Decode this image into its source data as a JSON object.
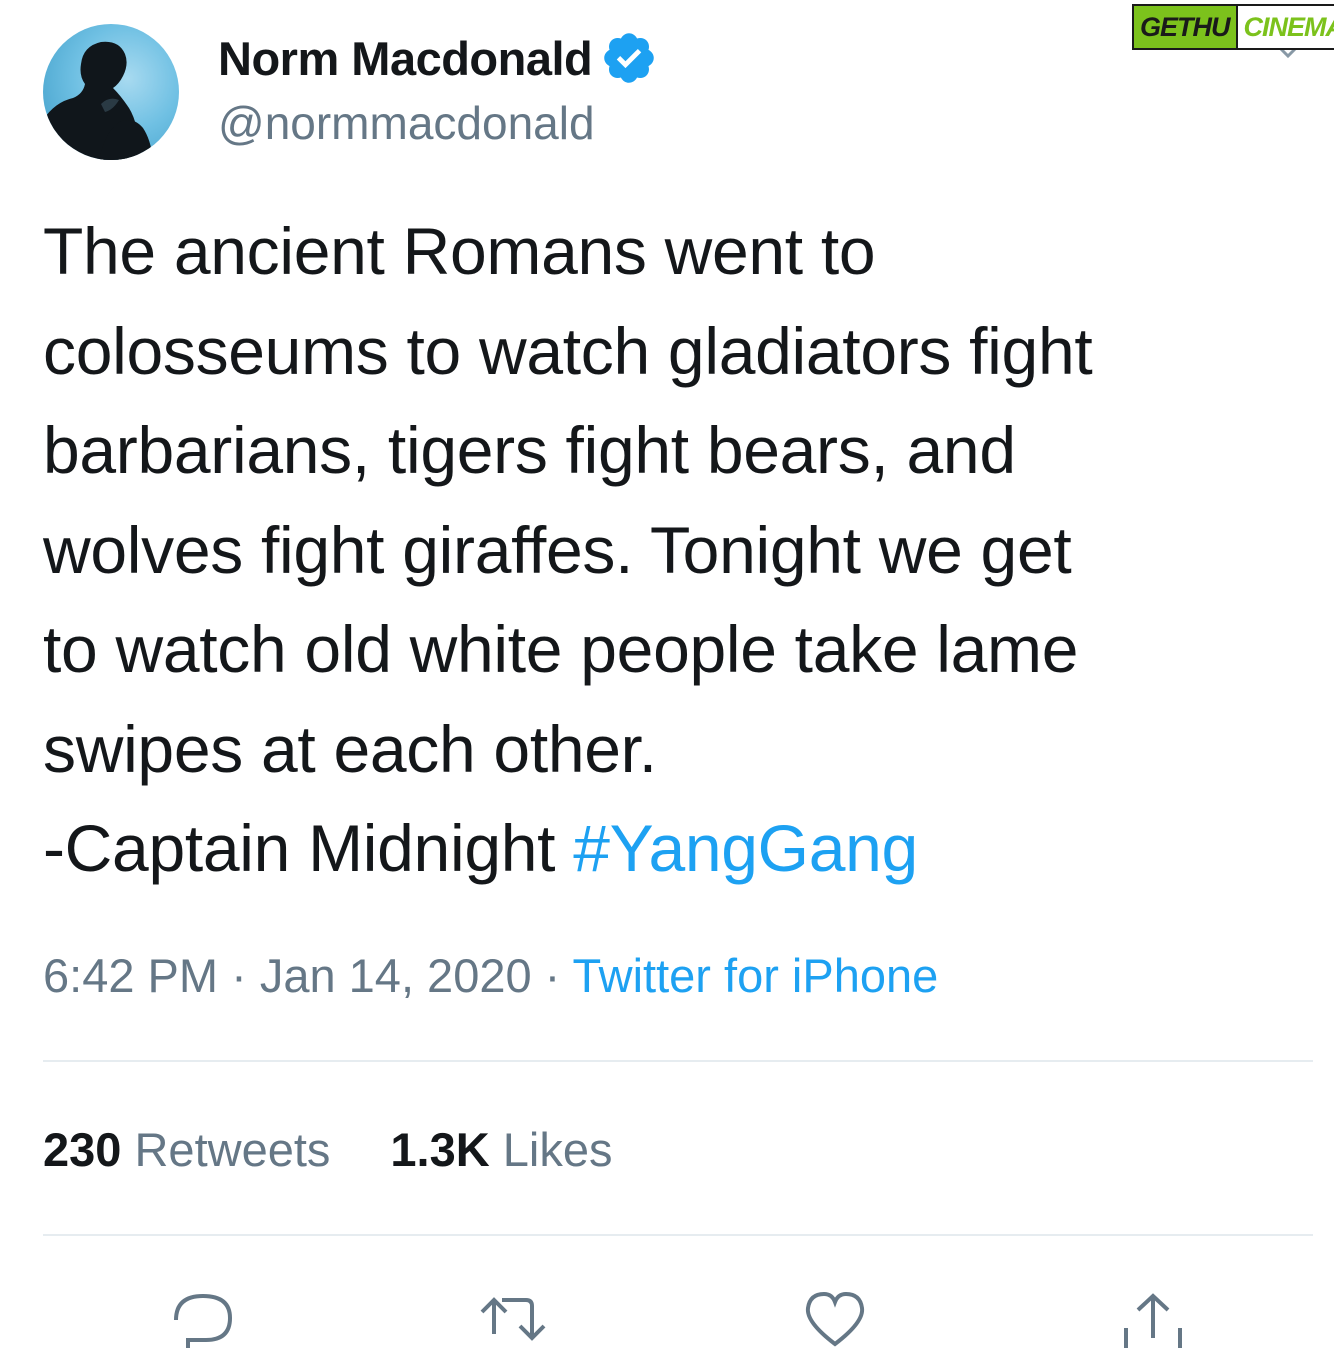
{
  "tweet": {
    "author": {
      "display_name": "Norm Macdonald",
      "handle": "@normmacdonald",
      "verified": true
    },
    "body_lines": [
      "The ancient Romans went to",
      "colosseums to watch gladiators fight",
      "barbarians, tigers fight bears, and",
      "wolves fight giraffes. Tonight we get",
      "to watch old white people take lame",
      "swipes at each other."
    ],
    "signature": "-Captain Midnight ",
    "hashtag": "#YangGang",
    "time": "6:42 PM",
    "date": "Jan 14, 2020",
    "separator": " · ",
    "source": "Twitter for iPhone",
    "stats": {
      "retweets_count": "230",
      "retweets_label": "Retweets",
      "likes_count": "1.3K",
      "likes_label": "Likes"
    }
  },
  "icons": {
    "verified": "verified-badge-icon",
    "reply": "reply-icon",
    "retweet": "retweet-icon",
    "like": "heart-icon",
    "share": "share-icon",
    "menu": "chevron-down-icon"
  },
  "watermark": {
    "left": "GETHU",
    "right": "CINEMA"
  },
  "colors": {
    "text": "#14171a",
    "secondary": "#657786",
    "link": "#1da1f2",
    "divider": "#e6ecf0"
  }
}
